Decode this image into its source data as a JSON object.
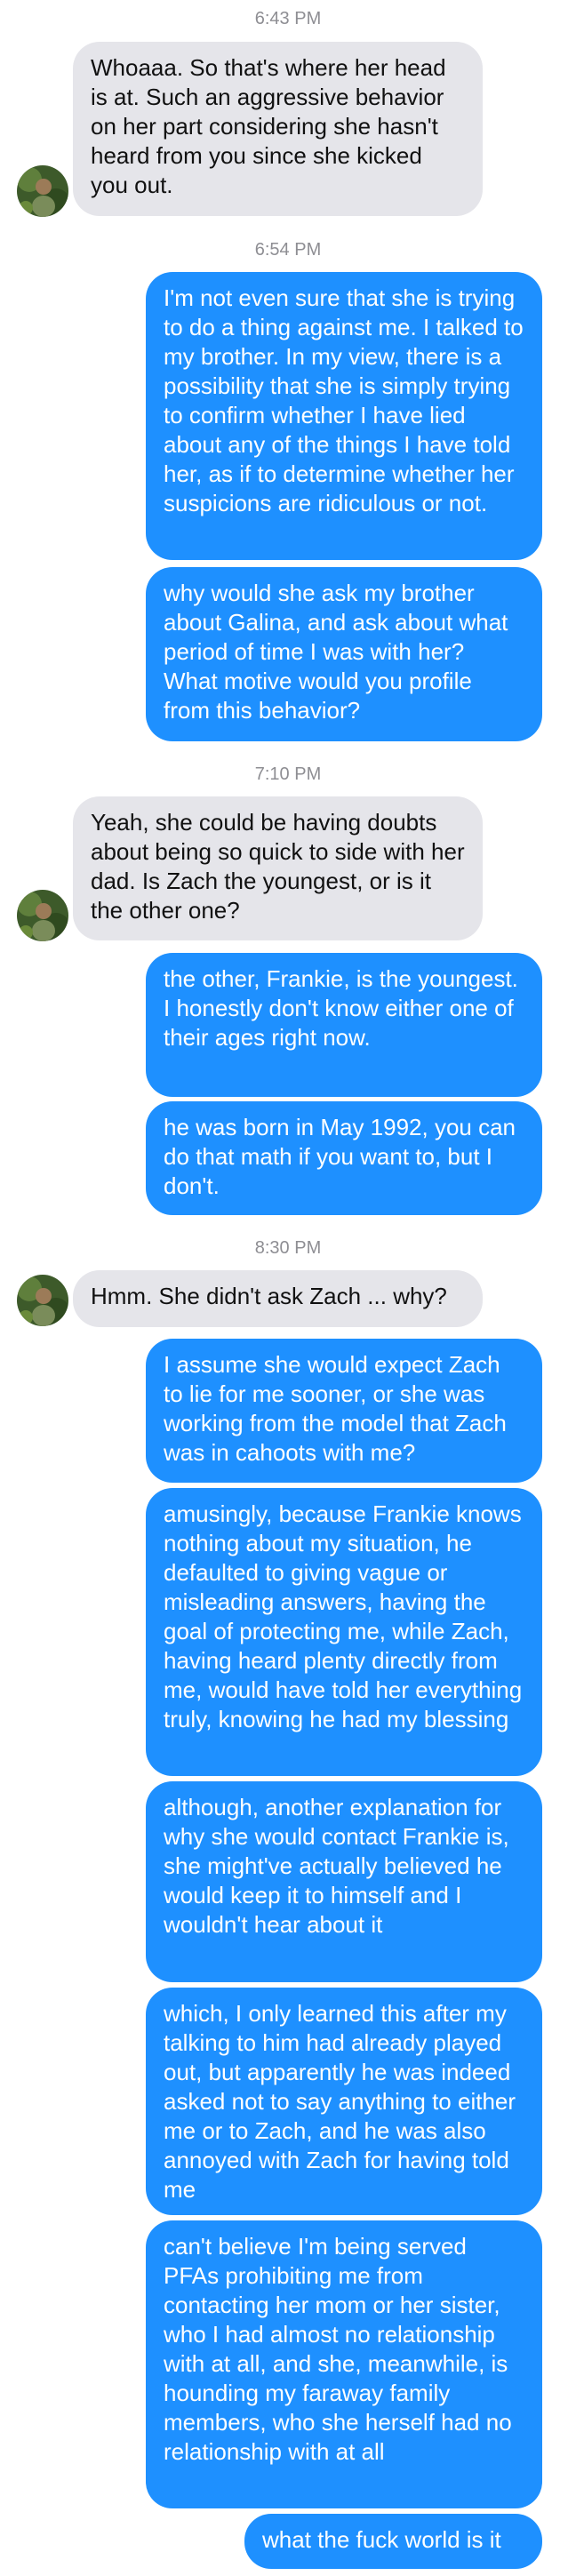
{
  "messages": {
    "ts1": "6:43 PM",
    "m1": "Whoaaa. So that's where her head is at. Such an aggressive behavior on her part considering she hasn't heard from you since she kicked you out.",
    "ts2": "6:54 PM",
    "m2": "I'm not even sure that she is trying to do a thing against me. I talked to my brother. In my view, there is a possibility that she is simply trying to confirm whether I have lied about any of the things I have told her, as if to determine whether her suspicions are ridiculous or not.",
    "m3": "why would she ask my brother about Galina, and ask about what period of time I was with her? What motive would you profile from this behavior?",
    "ts3": "7:10 PM",
    "m4": "Yeah, she could be having doubts about being so quick to side with her dad. Is Zach the youngest, or is it the other one?",
    "m5": "the other, Frankie, is the youngest. I honestly don't know either one of their ages right now.",
    "m6": "he was born in May 1992, you can do that math if you want to, but I don't.",
    "ts4": "8:30 PM",
    "m7": "Hmm. She didn't ask Zach ... why?",
    "m8": "I assume she would expect Zach to lie for me sooner, or she was working from the model that Zach was in cahoots with me?",
    "m9": "amusingly, because Frankie knows nothing about my situation, he defaulted to giving vague or misleading answers, having the goal of protecting me, while Zach, having heard plenty directly from me, would have told her everything truly, knowing he had my blessing",
    "m10": "although, another explanation for why she would contact Frankie is, she might've actually believed he would keep it to himself and I wouldn't hear about it",
    "m11": "which, I only learned this after my talking to him had already played out, but apparently he was indeed asked not to say anything to either me or to Zach, and he was also annoyed with Zach for having told me",
    "m12": "can't believe I'm being served PFAs prohibiting me from contacting her mom or her sister, who I had almost no relationship with at all, and she, meanwhile, is hounding my faraway family members, who she herself had no relationship with at all",
    "m13": "what the fuck world is it"
  },
  "colors": {
    "incoming_bubble": "#e5e5ea",
    "outgoing_bubble": "#1e90ff",
    "timestamp": "#8e8e93"
  },
  "icons": {
    "avatar": "contact-avatar-photo"
  }
}
